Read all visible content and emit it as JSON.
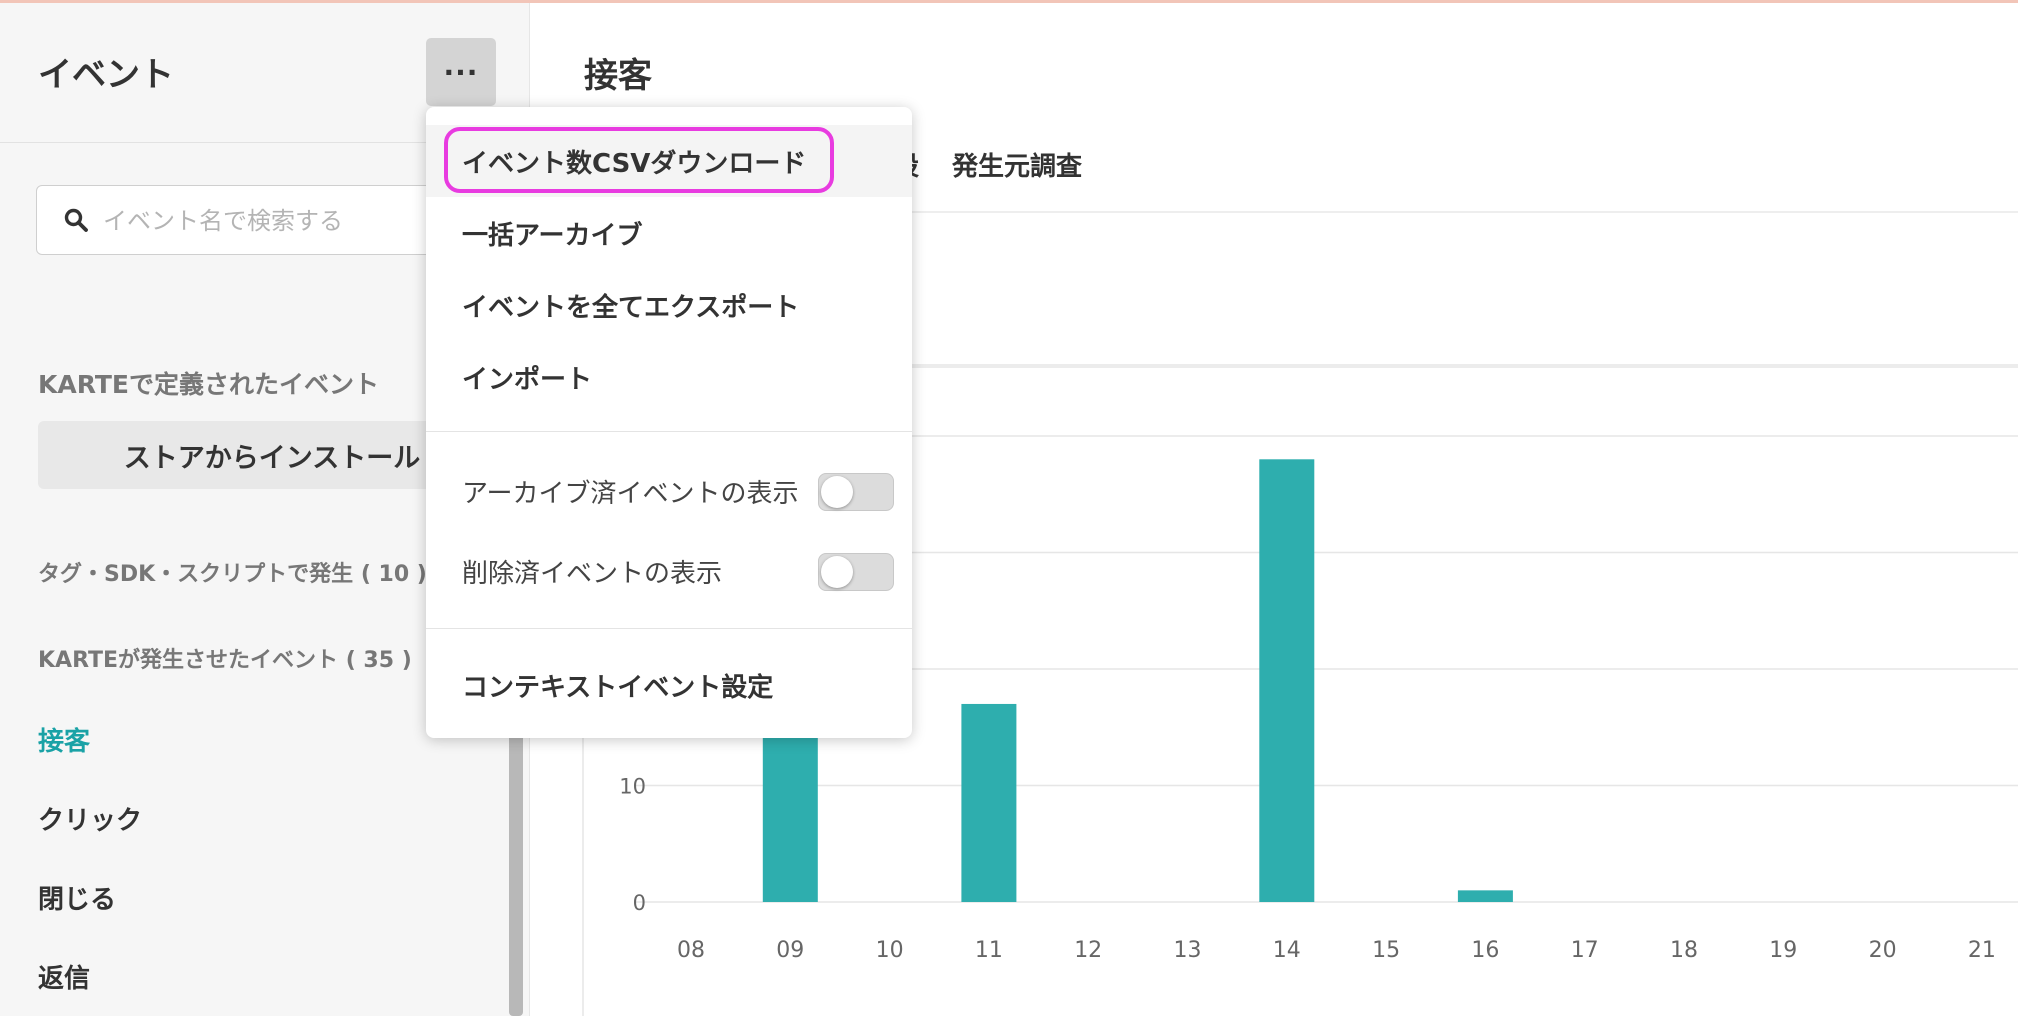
{
  "sidebar": {
    "title": "イベント",
    "more_label": "···",
    "search": {
      "placeholder": "イベント名で検索する",
      "value": ""
    },
    "karte_defined_heading": "KARTEで定義されたイベント",
    "store_install_label": "ストアからインストール",
    "tag_section_label": "タグ・SDK・スクリプトで発生 ( 10 )",
    "karte_generated_label": "KARTEが発生させたイベント ( 35 )",
    "events": [
      "接客",
      "クリック",
      "閉じる",
      "返信"
    ],
    "active_event": "接客"
  },
  "main": {
    "title": "接客",
    "tabs": [
      "設",
      "発生元調査"
    ]
  },
  "menu": {
    "items": [
      "イベント数CSVダウンロード",
      "一括アーカイブ",
      "イベントを全てエクスポート",
      "インポート"
    ],
    "toggles": [
      {
        "label": "アーカイブ済イベントの表示",
        "on": false
      },
      {
        "label": "削除済イベントの表示",
        "on": false
      }
    ],
    "context_settings": "コンテキストイベント設定"
  },
  "colors": {
    "accent": "#1aa2a6",
    "bar": "#2eaeae",
    "highlight": "#e83be0"
  },
  "chart_data": {
    "type": "bar",
    "categories": [
      "08",
      "09",
      "10",
      "11",
      "12",
      "13",
      "14",
      "15",
      "16",
      "17",
      "18",
      "19",
      "20",
      "21"
    ],
    "values": [
      0,
      20,
      0,
      17,
      0,
      0,
      38,
      0,
      1,
      0,
      0,
      0,
      0,
      0
    ],
    "yticks": [
      0,
      10
    ],
    "ylim": [
      0,
      40
    ],
    "grid": true
  }
}
